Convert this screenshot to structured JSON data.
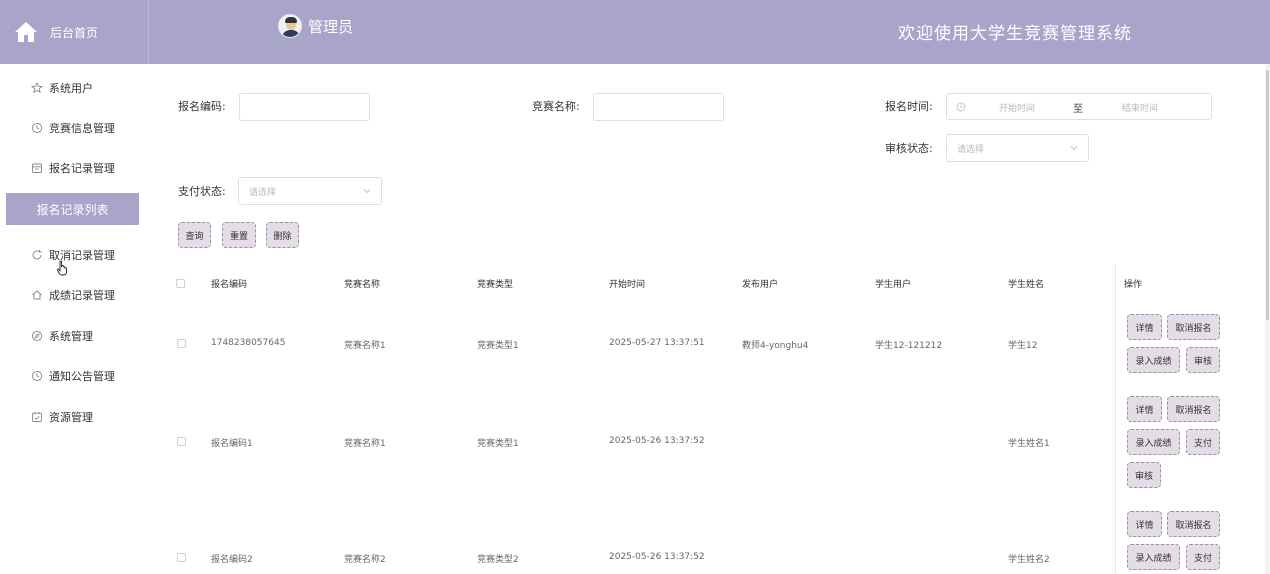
{
  "header": {
    "brand_label": "后台首页",
    "user_name": "管理员",
    "system_title": "欢迎使用大学生竞赛管理系统",
    "accent_color": "#a9a4ca"
  },
  "sidebar": {
    "items": [
      {
        "label": "系统用户",
        "icon": "star-icon"
      },
      {
        "label": "竞赛信息管理",
        "icon": "clock-icon"
      },
      {
        "label": "报名记录管理",
        "icon": "archive-icon"
      },
      {
        "label": "报名记录列表",
        "icon": "",
        "active": true
      },
      {
        "label": "取消记录管理",
        "icon": "refresh-icon"
      },
      {
        "label": "成绩记录管理",
        "icon": "house-icon"
      },
      {
        "label": "系统管理",
        "icon": "compass-icon"
      },
      {
        "label": "通知公告管理",
        "icon": "clock-icon"
      },
      {
        "label": "资源管理",
        "icon": "calendar-check-icon"
      }
    ]
  },
  "filters": {
    "code_label": "报名编码:",
    "code_value": "",
    "name_label": "竞赛名称:",
    "name_value": "",
    "time_label": "报名时间:",
    "time_start_placeholder": "开始时间",
    "time_separator": "至",
    "time_end_placeholder": "结束时间",
    "audit_label": "审核状态:",
    "audit_placeholder": "请选择",
    "pay_label": "支付状态:",
    "pay_placeholder": "请选择"
  },
  "actions": {
    "query": "查询",
    "reset": "重置",
    "delete": "删除"
  },
  "table": {
    "columns": [
      "报名编码",
      "竞赛名称",
      "竞赛类型",
      "开始时间",
      "发布用户",
      "学生用户",
      "学生姓名",
      "操作"
    ],
    "rows": [
      {
        "code": "1748238057645",
        "name": "竞赛名称1",
        "type": "竞赛类型1",
        "start": "2025-05-27 13:37:51",
        "publisher": "教师4-yonghu4",
        "student_user": "学生12-121212",
        "student_name": "学生12",
        "ops": [
          "详情",
          "取消报名",
          "录入成绩",
          "审核"
        ]
      },
      {
        "code": "报名编码1",
        "name": "竞赛名称1",
        "type": "竞赛类型1",
        "start": "2025-05-26 13:37:52",
        "publisher": "",
        "student_user": "",
        "student_name": "学生姓名1",
        "ops": [
          "详情",
          "取消报名",
          "录入成绩",
          "支付",
          "审核"
        ]
      },
      {
        "code": "报名编码2",
        "name": "竞赛名称2",
        "type": "竞赛类型2",
        "start": "2025-05-26 13:37:52",
        "publisher": "",
        "student_user": "",
        "student_name": "学生姓名2",
        "ops": [
          "详情",
          "取消报名",
          "录入成绩",
          "支付"
        ]
      }
    ]
  }
}
